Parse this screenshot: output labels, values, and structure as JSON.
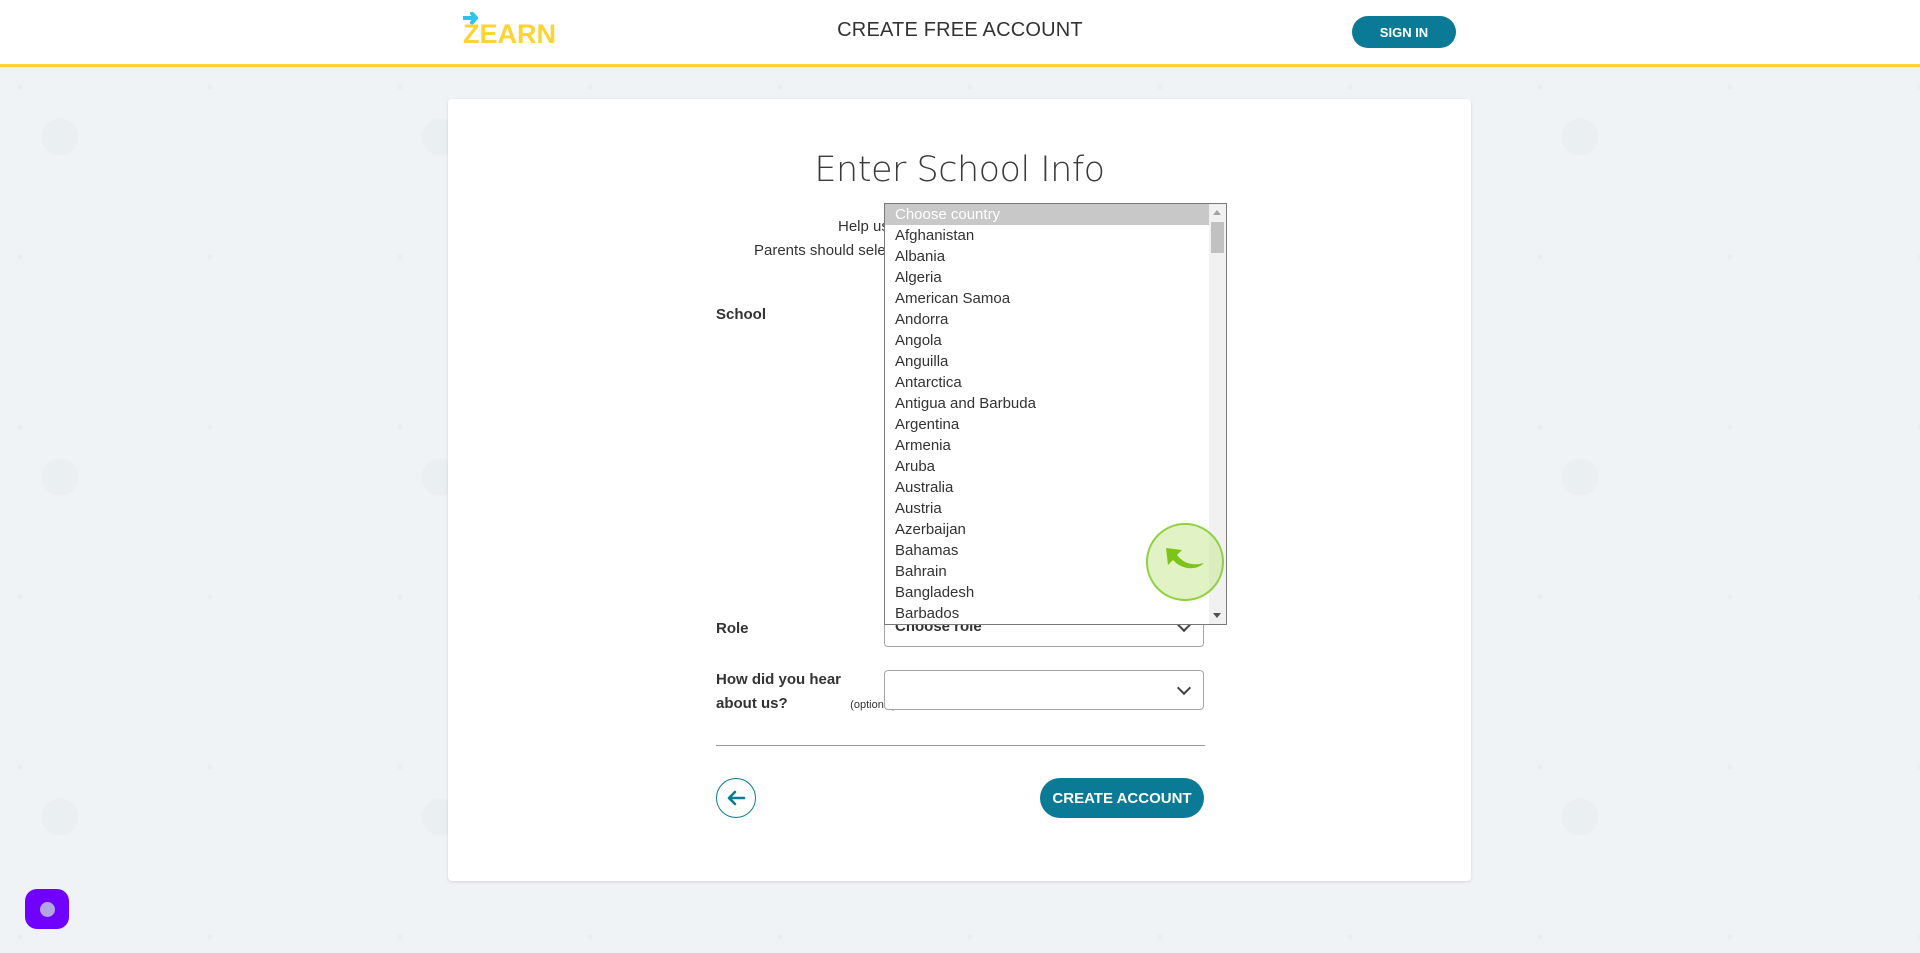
{
  "header": {
    "logo_text": "ZEARN",
    "title": "CREATE FREE ACCOUNT",
    "sign_in_label": "SIGN IN"
  },
  "form": {
    "title": "Enter School Info",
    "helper_line_1_visible": "Help us",
    "helper_line_2_visible": "Parents should sele",
    "school_label": "School",
    "role_label": "Role",
    "role_value": "Choose role",
    "hear_label": "How did you hear about us?",
    "hear_optional": "(optional)",
    "hear_value": "",
    "create_account_label": "CREATE ACCOUNT"
  },
  "country_listbox": {
    "selected": "Choose country",
    "options": [
      "Choose country",
      "Afghanistan",
      "Albania",
      "Algeria",
      "American Samoa",
      "Andorra",
      "Angola",
      "Anguilla",
      "Antarctica",
      "Antigua and Barbuda",
      "Argentina",
      "Armenia",
      "Aruba",
      "Australia",
      "Austria",
      "Azerbaijan",
      "Bahamas",
      "Bahrain",
      "Bangladesh",
      "Barbados"
    ]
  },
  "icons": {
    "back": "arrow-left-icon",
    "chevron": "chevron-down-icon",
    "click_indicator": "cursor-arrow-icon",
    "chat": "chat-widget-icon"
  },
  "colors": {
    "brand_teal": "#0a7a96",
    "brand_yellow": "#fcd535",
    "logo_blue": "#2ec4e6",
    "chat_purple": "#7000ff"
  }
}
